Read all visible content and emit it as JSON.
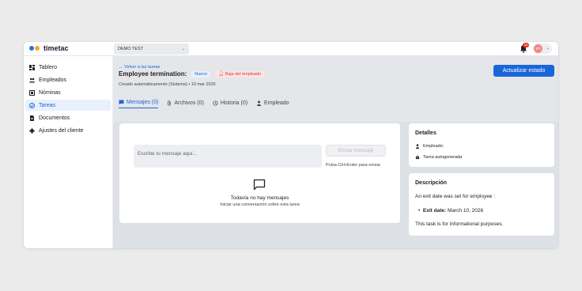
{
  "app": {
    "logo_text": "timetac"
  },
  "topbar": {
    "company_select": "DEMO TEST",
    "notification_count": "10",
    "avatar_initials": "PT"
  },
  "sidebar": {
    "items": [
      {
        "label": "Tablero",
        "icon": "dashboard-icon"
      },
      {
        "label": "Empleados",
        "icon": "users-icon"
      },
      {
        "label": "Nóminas",
        "icon": "payroll-icon"
      },
      {
        "label": "Tareas",
        "icon": "tasks-icon"
      },
      {
        "label": "Documentos",
        "icon": "document-icon"
      },
      {
        "label": "Ajustes del cliente",
        "icon": "gear-icon"
      }
    ],
    "active_index": 3
  },
  "header": {
    "back_link": "Volver a las tareas",
    "title": "Employee termination:",
    "status_badge": "Nuevo",
    "type_badge": "Baja del empleado",
    "meta": "Creado automáticamente (Sistema) • 10 mar 2026",
    "update_button": "Actualizar estado"
  },
  "tabs": [
    {
      "label": "Mensajes (0)",
      "icon": "message-icon"
    },
    {
      "label": "Archivos (0)",
      "icon": "paperclip-icon"
    },
    {
      "label": "Historia (0)",
      "icon": "history-icon"
    },
    {
      "label": "Empleado",
      "icon": "person-icon"
    }
  ],
  "messages": {
    "placeholder": "Escribe tu mensaje aquí...",
    "send_button": "Enviar mensaje",
    "hint": "Pulsa Ctrl+Enter para enviar",
    "empty_title": "Todavía no hay mensajes",
    "empty_subtitle": "Iniciar una conversación sobre esta tarea"
  },
  "details": {
    "heading": "Detalles",
    "employee_label": "Empleado:",
    "auto_label": "Tarea autogenerada"
  },
  "description": {
    "heading": "Descripción",
    "line1": "An exit date was set for employee :",
    "bullet_label": "Exit date:",
    "bullet_value": "March 10, 2026",
    "line2": "This task is for informational purposes."
  },
  "colors": {
    "accent": "#1a66d9",
    "danger": "#d9393d",
    "brand_orange": "#f5a623"
  }
}
